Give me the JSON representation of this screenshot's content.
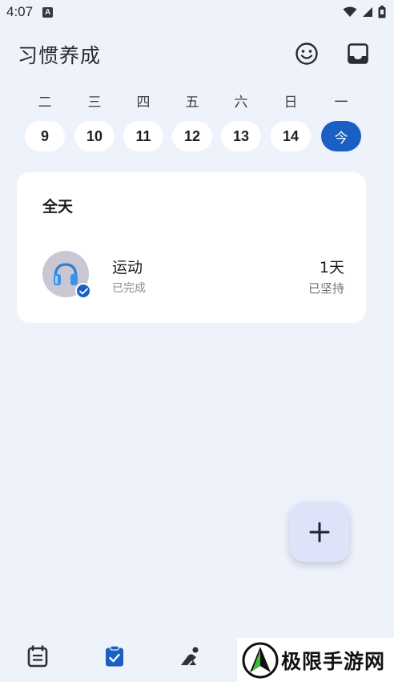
{
  "status_bar": {
    "time": "4:07",
    "notification_icon": "a-letter-icon",
    "icons": [
      "wifi-icon",
      "signal-icon",
      "battery-icon"
    ]
  },
  "app_bar": {
    "title": "习惯养成",
    "actions": [
      "smile-icon",
      "inbox-icon"
    ]
  },
  "week": {
    "days": [
      {
        "label": "二",
        "number": "9"
      },
      {
        "label": "三",
        "number": "10"
      },
      {
        "label": "四",
        "number": "11"
      },
      {
        "label": "五",
        "number": "12"
      },
      {
        "label": "六",
        "number": "13"
      },
      {
        "label": "日",
        "number": "14"
      },
      {
        "label": "一",
        "number": "今",
        "selected": true
      }
    ]
  },
  "habits_card": {
    "section_title": "全天",
    "habit": {
      "icon": "headphones-icon",
      "name": "运动",
      "status": "已完成",
      "streak_value": "1天",
      "streak_label": "已坚持"
    }
  },
  "fab": {
    "icon": "plus-icon"
  },
  "bottom_nav": {
    "items": [
      {
        "icon": "calendar-note-icon",
        "selected": false
      },
      {
        "icon": "clipboard-check-icon",
        "selected": true
      },
      {
        "icon": "meditation-icon",
        "selected": false
      }
    ]
  },
  "watermark": {
    "text": "极限手游网"
  },
  "colors": {
    "background": "#eef2fb",
    "accent": "#1a5fc4",
    "card": "#ffffff",
    "fab": "#dde4f9"
  }
}
